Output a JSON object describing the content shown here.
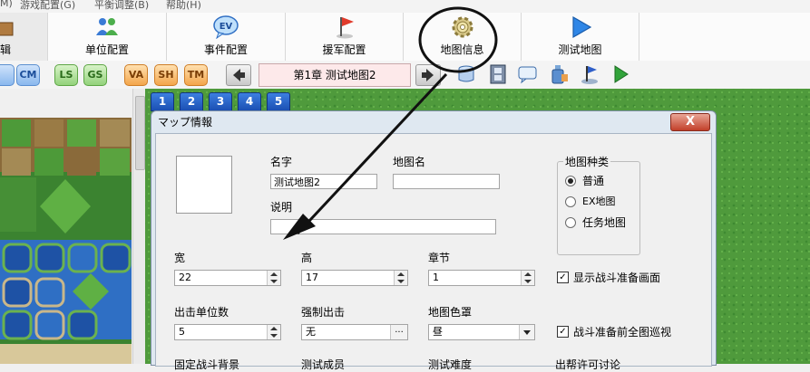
{
  "menubar": {
    "items": [
      "M)",
      "游戏配置(G)",
      "平衡调整(B)",
      "帮助(H)"
    ]
  },
  "toolbar": {
    "partial_label": "辑",
    "buttons": [
      {
        "label": "单位配置",
        "icon": "units-icon"
      },
      {
        "label": "事件配置",
        "icon": "ev-event-icon"
      },
      {
        "label": "援军配置",
        "icon": "flag-icon"
      },
      {
        "label": "地图信息",
        "icon": "gear-icon"
      },
      {
        "label": "测试地图",
        "icon": "play-triangle-icon"
      }
    ]
  },
  "toolbar2": {
    "pills": [
      "CM",
      "LS",
      "GS",
      "VA",
      "SH",
      "TM"
    ],
    "map_title": "第1章 测试地图2"
  },
  "map_tabs": [
    "1",
    "2",
    "3",
    "4",
    "5"
  ],
  "dialog": {
    "title": "マップ情報",
    "close_label": "X",
    "name_label": "名字",
    "name_value": "测试地图2",
    "mapname_label": "地图名",
    "mapname_value": "",
    "desc_label": "说明",
    "desc_value": "",
    "maptype": {
      "label": "地图种类",
      "options": [
        "普通",
        "EX地图",
        "任务地图"
      ],
      "selected": "普通"
    },
    "width_label": "宽",
    "width_value": "22",
    "height_label": "高",
    "height_value": "17",
    "chapter_label": "章节",
    "chapter_value": "1",
    "show_prep_label": "显示战斗准备画面",
    "show_prep_checked": true,
    "sortie_label": "出击单位数",
    "sortie_value": "5",
    "forced_label": "强制出击",
    "forced_value": "无",
    "forced_button": "...",
    "tint_label": "地图色罩",
    "tint_value": "昼",
    "patrol_label": "战斗准备前全图巡视",
    "patrol_checked": true,
    "cut_labels": [
      "固定战斗背景",
      "测试成员",
      "测试难度",
      "出帮许可讨论"
    ]
  },
  "colors": {
    "dialog_bg": "#dfe8f1",
    "map_tint_title": "#fde9ea",
    "grass": "#4f9a3c",
    "tab_blue": "#1b4fb3"
  }
}
